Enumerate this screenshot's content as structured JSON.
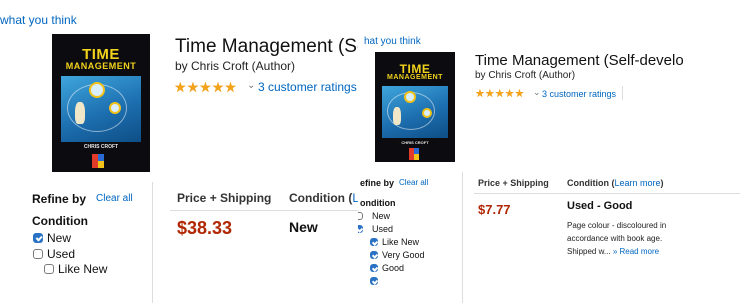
{
  "panel1": {
    "header_link": "what you think",
    "product_title": "Time Management (Self-",
    "author": "by Chris Croft (Author)",
    "rating_text": "3 customer ratings",
    "cover": {
      "title_line1": "TIME",
      "title_line2": "MANAGEMENT",
      "author": "CHRIS CROFT"
    },
    "refine_label": "Refine by",
    "clear_all": "Clear all",
    "condition_heading": "Condition",
    "filters": [
      {
        "label": "New",
        "checked": true
      },
      {
        "label": "Used",
        "checked": false
      },
      {
        "label": "Like New",
        "checked": false
      }
    ],
    "col_price": "Price + Shipping",
    "col_condition": "Condition (",
    "col_condition_link": "Lea",
    "price": "$38.33",
    "condition_value": "New"
  },
  "panel2": {
    "header_link": "hat you think",
    "product_title": "Time Management (Self-develo",
    "author": "by Chris Croft (Author)",
    "rating_text": "3 customer ratings",
    "cover": {
      "title_line1": "TIME",
      "title_line2": "MANAGEMENT",
      "author": "CHRIS CROFT"
    },
    "refine_label": "efine by",
    "clear_all": "Clear all",
    "condition_heading": "ondition",
    "filters": [
      {
        "label": "New",
        "checked": false
      },
      {
        "label": "Used",
        "checked": true
      },
      {
        "label": "Like New",
        "checked": true
      },
      {
        "label": "Very Good",
        "checked": true
      },
      {
        "label": "Good",
        "checked": true
      }
    ],
    "col_price": "Price + Shipping",
    "col_condition": "Condition (",
    "col_condition_link": "Learn more",
    "col_condition_end": ")",
    "price": "$7.77",
    "condition_value": "Used - Good",
    "comment_line1": "Page colour -  discoloured in",
    "comment_line2": "accordance with book age.",
    "comment_line3": "Shipped w... ",
    "read_more": "» Read more"
  },
  "colors": {
    "link": "#0066c0",
    "price": "#b12704",
    "star": "#f4a41c",
    "checkbox": "#2a72c3"
  },
  "rating_stars": 5
}
